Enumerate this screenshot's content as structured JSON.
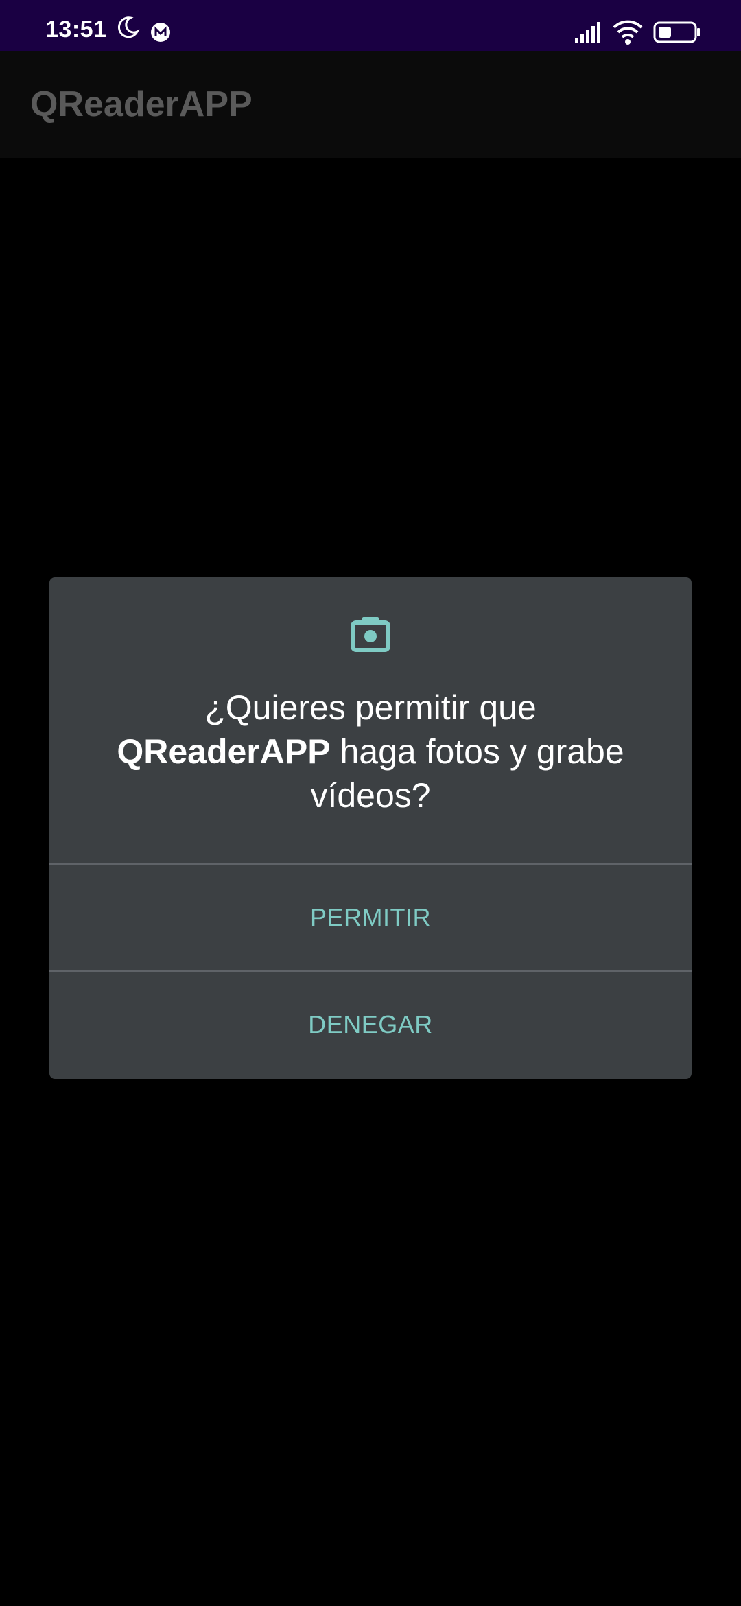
{
  "status_bar": {
    "time": "13:51",
    "icons": [
      "moon-icon",
      "m-notification-icon",
      "signal-icon",
      "wifi-icon",
      "battery-icon"
    ]
  },
  "app_bar": {
    "title": "QReaderAPP"
  },
  "dialog": {
    "icon": "camera-icon",
    "message_before": "¿Quieres permitir que",
    "app_name": "QReaderAPP",
    "message_after": "haga fotos y grabe vídeos?",
    "allow_label": "PERMITIR",
    "deny_label": "DENEGAR"
  },
  "colors": {
    "status_bar_bg": "#1a0043",
    "dialog_bg": "#3c4043",
    "accent": "#7fcbc4",
    "app_title": "#5a5a5a"
  }
}
